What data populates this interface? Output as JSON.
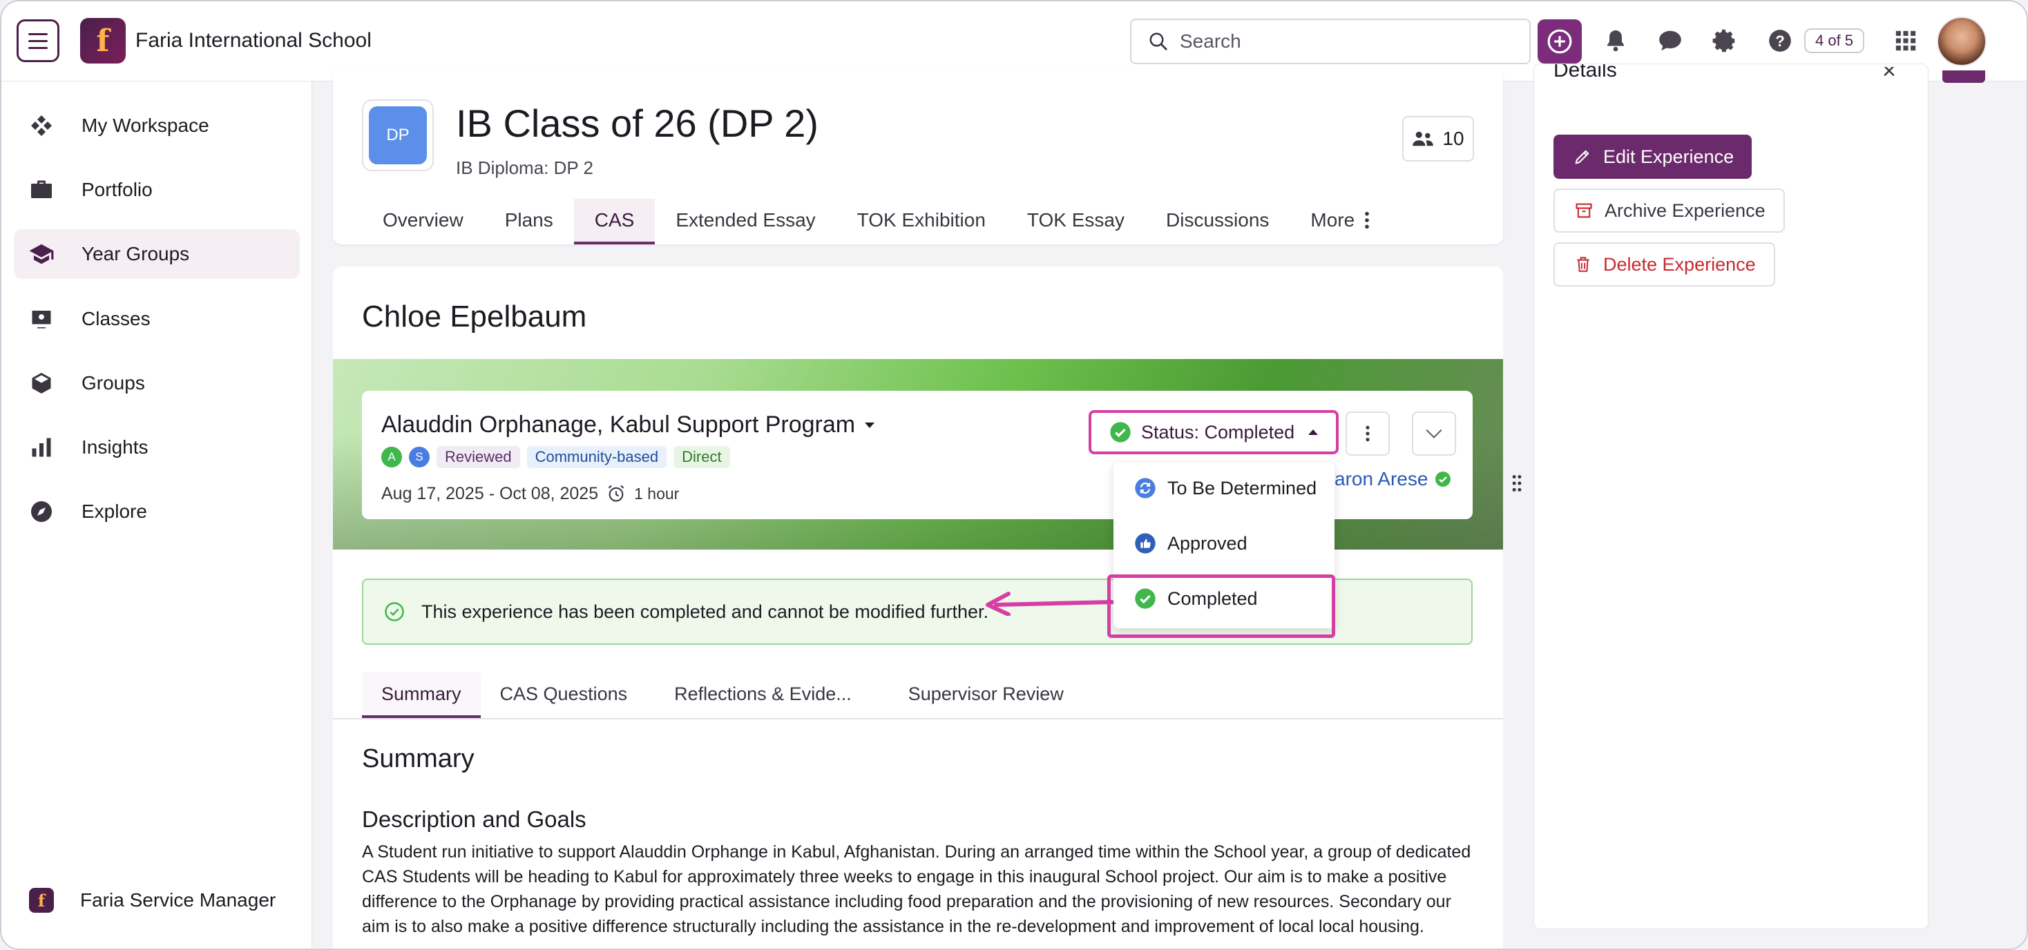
{
  "header": {
    "school_name": "Faria International School",
    "search_placeholder": "Search",
    "page_counter": "4 of 5"
  },
  "sidebar": {
    "items": [
      {
        "label": "My Workspace",
        "icon": "workspace-icon"
      },
      {
        "label": "Portfolio",
        "icon": "briefcase-icon"
      },
      {
        "label": "Year Groups",
        "icon": "graduation-cap-icon",
        "active": true
      },
      {
        "label": "Classes",
        "icon": "classes-icon"
      },
      {
        "label": "Groups",
        "icon": "cube-icon"
      },
      {
        "label": "Insights",
        "icon": "bar-chart-icon"
      },
      {
        "label": "Explore",
        "icon": "compass-icon"
      }
    ],
    "footer_label": "Faria Service Manager"
  },
  "class": {
    "badge": "DP",
    "title": "IB Class of 26 (DP 2)",
    "subtitle": "IB Diploma: DP 2",
    "member_count": "10",
    "tabs": [
      "Overview",
      "Plans",
      "CAS",
      "Extended Essay",
      "TOK Exhibition",
      "TOK Essay",
      "Discussions",
      "More"
    ],
    "active_tab": "CAS"
  },
  "student": {
    "name": "Chloe Epelbaum"
  },
  "experience": {
    "title": "Alauddin Orphanage, Kabul Support Program",
    "dots": [
      "A",
      "S"
    ],
    "tags": [
      "Reviewed",
      "Community-based",
      "Direct"
    ],
    "dates": "Aug 17, 2025 - Oct 08, 2025",
    "duration": "1 hour",
    "status_label": "Status: Completed",
    "supervisor": "aron Arese",
    "status_options": [
      "To Be Determined",
      "Approved",
      "Completed"
    ]
  },
  "alert": {
    "text": "This experience has been completed and cannot be modified further."
  },
  "subtabs": [
    "Summary",
    "CAS Questions",
    "Reflections & Evide...",
    "Supervisor Review"
  ],
  "summary": {
    "section_title": "Summary",
    "desc_title": "Description and Goals",
    "desc_text": "A Student run initiative to support Alauddin Orphange in Kabul, Afghanistan. During an arranged time within the School year, a group of dedicated CAS Students will be heading to Kabul for approximately three weeks to engage in this inaugural School project. Our aim is to make a positive difference to the Orphanage by providing practical assistance including food preparation and the provisioning of new resources. Secondary our aim is to also make a positive difference structurally including the assistance in the re-development and improvement of local local housing."
  },
  "details": {
    "title": "Details",
    "close": "×",
    "edit_label": "Edit Experience",
    "archive_label": "Archive Experience",
    "delete_label": "Delete Experience"
  },
  "colors": {
    "brand": "#6b2a6b",
    "highlight": "#d63ea4",
    "success": "#3fb74a",
    "danger": "#c8282e",
    "link": "#2a5ab8"
  }
}
